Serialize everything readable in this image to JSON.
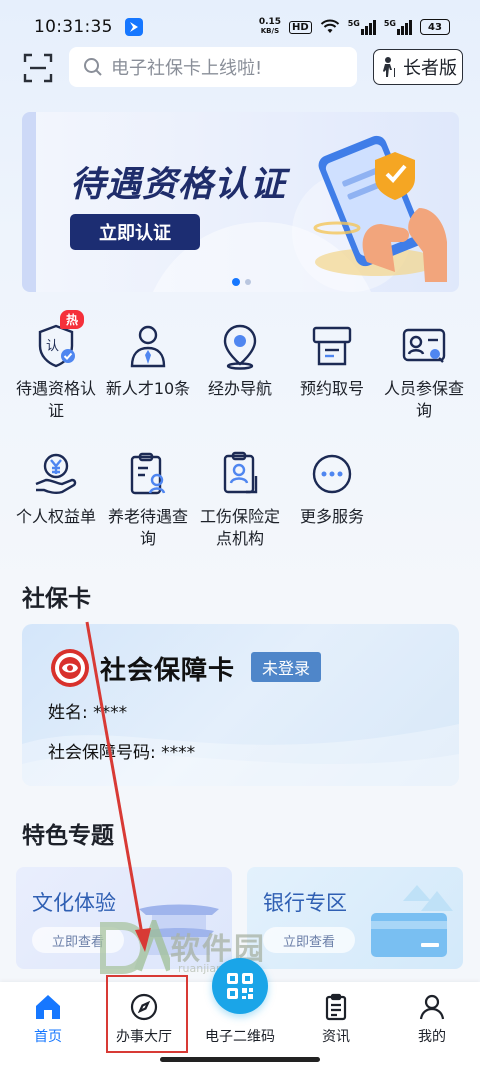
{
  "status_bar": {
    "time": "10:31:35",
    "net_speed_value": "0.15",
    "net_speed_unit": "KB/S",
    "hd_badge": "HD",
    "signal_1": "5G",
    "signal_2": "5G",
    "battery": "43"
  },
  "header": {
    "search_placeholder": "电子社保卡上线啦!",
    "elder_label": "长者版"
  },
  "banner": {
    "title": "待遇资格认证",
    "button": "立即认证",
    "active_slide": 1,
    "slide_count": 2
  },
  "services": [
    {
      "label": "待遇资格认证",
      "icon": "person-check-icon",
      "badge": "热"
    },
    {
      "label": "新人才10条",
      "icon": "talent-person-icon"
    },
    {
      "label": "经办导航",
      "icon": "location-pin-icon"
    },
    {
      "label": "预约取号",
      "icon": "ticket-machine-icon"
    },
    {
      "label": "人员参保查询",
      "icon": "id-card-search-icon"
    },
    {
      "label": "个人权益单",
      "icon": "money-hand-icon"
    },
    {
      "label": "养老待遇查询",
      "icon": "clipboard-person-icon"
    },
    {
      "label": "工伤保险定点机构",
      "icon": "injury-document-icon"
    },
    {
      "label": "更多服务",
      "icon": "more-dots-icon"
    }
  ],
  "social_card_section": {
    "title": "社保卡",
    "card_title": "社会保障卡",
    "login_status": "未登录",
    "name_label": "姓名:",
    "name_value": "****",
    "number_label": "社会保障号码:",
    "number_value": "****"
  },
  "features_section": {
    "title": "特色专题",
    "cards": [
      {
        "title": "文化体验",
        "button": "立即查看"
      },
      {
        "title": "银行专区",
        "button": "立即查看"
      }
    ]
  },
  "watermark": {
    "text": "软件园",
    "subtext": "ruanjian.com"
  },
  "bottom_nav": [
    {
      "label": "首页",
      "icon": "home-icon",
      "active": true
    },
    {
      "label": "办事大厅",
      "icon": "compass-icon",
      "active": false
    },
    {
      "label": "电子二维码",
      "icon": "qr-code-icon",
      "active": false
    },
    {
      "label": "资讯",
      "icon": "news-clipboard-icon",
      "active": false
    },
    {
      "label": "我的",
      "icon": "user-icon",
      "active": false
    }
  ],
  "colors": {
    "primary": "#1677ff",
    "banner_title": "#1f2d6b",
    "annotation": "#d83a35",
    "qr_button": "#1aa5e8"
  }
}
